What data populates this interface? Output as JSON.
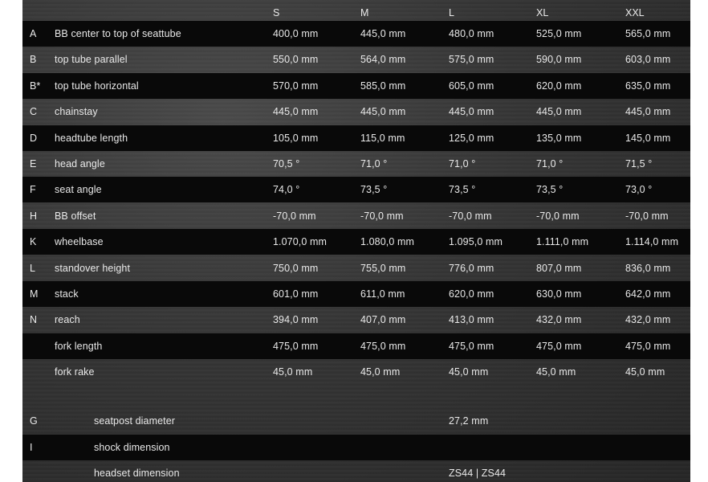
{
  "header": {
    "sizes": [
      "S",
      "M",
      "L",
      "XL",
      "XXL"
    ]
  },
  "rows": [
    {
      "code": "A",
      "label": "BB center to top of seattube",
      "values": [
        "400,0 mm",
        "445,0 mm",
        "480,0 mm",
        "525,0 mm",
        "565,0 mm"
      ]
    },
    {
      "code": "B",
      "label": "top tube parallel",
      "values": [
        "550,0 mm",
        "564,0 mm",
        "575,0 mm",
        "590,0 mm",
        "603,0 mm"
      ]
    },
    {
      "code": "B*",
      "label": "top tube horizontal",
      "values": [
        "570,0 mm",
        "585,0 mm",
        "605,0 mm",
        "620,0 mm",
        "635,0 mm"
      ]
    },
    {
      "code": "C",
      "label": "chainstay",
      "values": [
        "445,0 mm",
        "445,0 mm",
        "445,0 mm",
        "445,0 mm",
        "445,0 mm"
      ]
    },
    {
      "code": "D",
      "label": "headtube length",
      "values": [
        "105,0 mm",
        "115,0 mm",
        "125,0 mm",
        "135,0 mm",
        "145,0 mm"
      ]
    },
    {
      "code": "E",
      "label": "head angle",
      "values": [
        "70,5 °",
        "71,0 °",
        "71,0 °",
        "71,0 °",
        "71,5 °"
      ]
    },
    {
      "code": "F",
      "label": "seat angle",
      "values": [
        "74,0 °",
        "73,5 °",
        "73,5 °",
        "73,5 °",
        "73,0 °"
      ]
    },
    {
      "code": "H",
      "label": "BB offset",
      "values": [
        "-70,0 mm",
        "-70,0 mm",
        "-70,0 mm",
        "-70,0 mm",
        "-70,0 mm"
      ]
    },
    {
      "code": "K",
      "label": "wheelbase",
      "values": [
        "1.070,0 mm",
        "1.080,0 mm",
        "1.095,0 mm",
        "1.111,0 mm",
        "1.114,0 mm"
      ]
    },
    {
      "code": "L",
      "label": "standover height",
      "values": [
        "750,0 mm",
        "755,0 mm",
        "776,0 mm",
        "807,0 mm",
        "836,0 mm"
      ]
    },
    {
      "code": "M",
      "label": "stack",
      "values": [
        "601,0 mm",
        "611,0 mm",
        "620,0 mm",
        "630,0 mm",
        "642,0 mm"
      ]
    },
    {
      "code": "N",
      "label": "reach",
      "values": [
        "394,0 mm",
        "407,0 mm",
        "413,0 mm",
        "432,0 mm",
        "432,0 mm"
      ]
    },
    {
      "code": "",
      "label": "fork length",
      "values": [
        "475,0 mm",
        "475,0 mm",
        "475,0 mm",
        "475,0 mm",
        "475,0 mm"
      ]
    },
    {
      "code": "",
      "label": "fork rake",
      "values": [
        "45,0 mm",
        "45,0 mm",
        "45,0 mm",
        "45,0 mm",
        "45,0 mm"
      ]
    }
  ],
  "general": [
    {
      "code": "G",
      "label": "seatpost diameter",
      "value": "27,2 mm"
    },
    {
      "code": "I",
      "label": "shock dimension",
      "value": ""
    },
    {
      "code": "",
      "label": "headset dimension",
      "value": "ZS44 | ZS44"
    }
  ]
}
